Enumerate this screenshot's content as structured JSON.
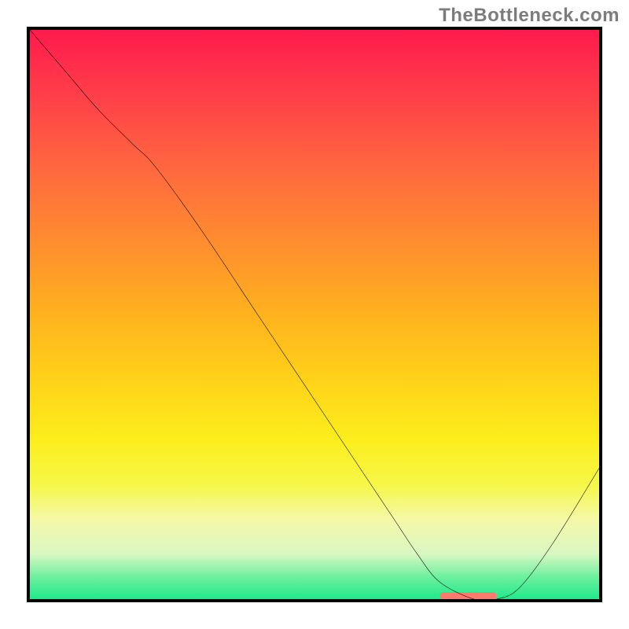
{
  "watermark": "TheBottleneck.com",
  "chart_data": {
    "type": "line",
    "title": "",
    "xlabel": "",
    "ylabel": "",
    "xlim": [
      0,
      100
    ],
    "ylim": [
      0,
      100
    ],
    "gradient_stops": [
      {
        "pos": 0,
        "color": "#ff1a4d"
      },
      {
        "pos": 10,
        "color": "#ff3a4a"
      },
      {
        "pos": 25,
        "color": "#ff6a3e"
      },
      {
        "pos": 38,
        "color": "#ff8f2e"
      },
      {
        "pos": 50,
        "color": "#ffb21e"
      },
      {
        "pos": 62,
        "color": "#ffd319"
      },
      {
        "pos": 72,
        "color": "#fcee1c"
      },
      {
        "pos": 80,
        "color": "#f6f74a"
      },
      {
        "pos": 86,
        "color": "#f4f8a8"
      },
      {
        "pos": 92,
        "color": "#d9f7c2"
      },
      {
        "pos": 96,
        "color": "#6ff0a0"
      },
      {
        "pos": 100,
        "color": "#1fe98a"
      }
    ],
    "series": [
      {
        "name": "bottleneck-curve",
        "x": [
          0,
          6,
          12,
          18,
          22,
          30,
          40,
          50,
          58,
          64,
          68,
          72,
          78,
          82,
          86,
          92,
          100
        ],
        "values": [
          100,
          93,
          86,
          80,
          76,
          65,
          50,
          35,
          23,
          14,
          8,
          3,
          0,
          0,
          2,
          10,
          23
        ]
      }
    ],
    "highlight_bar": {
      "x_start": 72,
      "x_end": 82,
      "y": 0,
      "color": "#ff7a6e",
      "thickness_pct": 1.2
    }
  }
}
